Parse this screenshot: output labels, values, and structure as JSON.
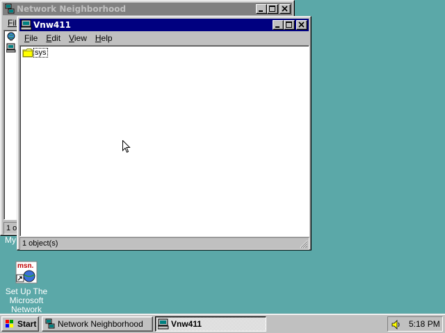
{
  "back_window": {
    "title": "Network Neighborhood",
    "menu_file_fragment": "File",
    "status_fragment": "1 ol"
  },
  "front_window": {
    "title": "Vnw411",
    "menu": [
      {
        "label": "File",
        "accel": "F",
        "rest": "ile"
      },
      {
        "label": "Edit",
        "accel": "E",
        "rest": "dit"
      },
      {
        "label": "View",
        "accel": "V",
        "rest": "iew"
      },
      {
        "label": "Help",
        "accel": "H",
        "rest": "elp"
      }
    ],
    "items": [
      {
        "label": "sys",
        "icon": "folder-icon"
      }
    ],
    "status": "1 object(s)"
  },
  "desktop": {
    "my_fragment": "My",
    "msn_label_lines": [
      "Set Up The",
      "Microsoft",
      "Network"
    ],
    "msn_icon_text": "msn."
  },
  "taskbar": {
    "start_label": "Start",
    "tasks": [
      {
        "label": "Network Neighborhood",
        "pressed": false
      },
      {
        "label": "Vnw411",
        "pressed": true
      }
    ],
    "clock": "5:18 PM"
  },
  "colors": {
    "desktop": "#5ba8a8",
    "active_title": "#000080",
    "inactive_title": "#808080",
    "face": "#c0c0c0"
  }
}
